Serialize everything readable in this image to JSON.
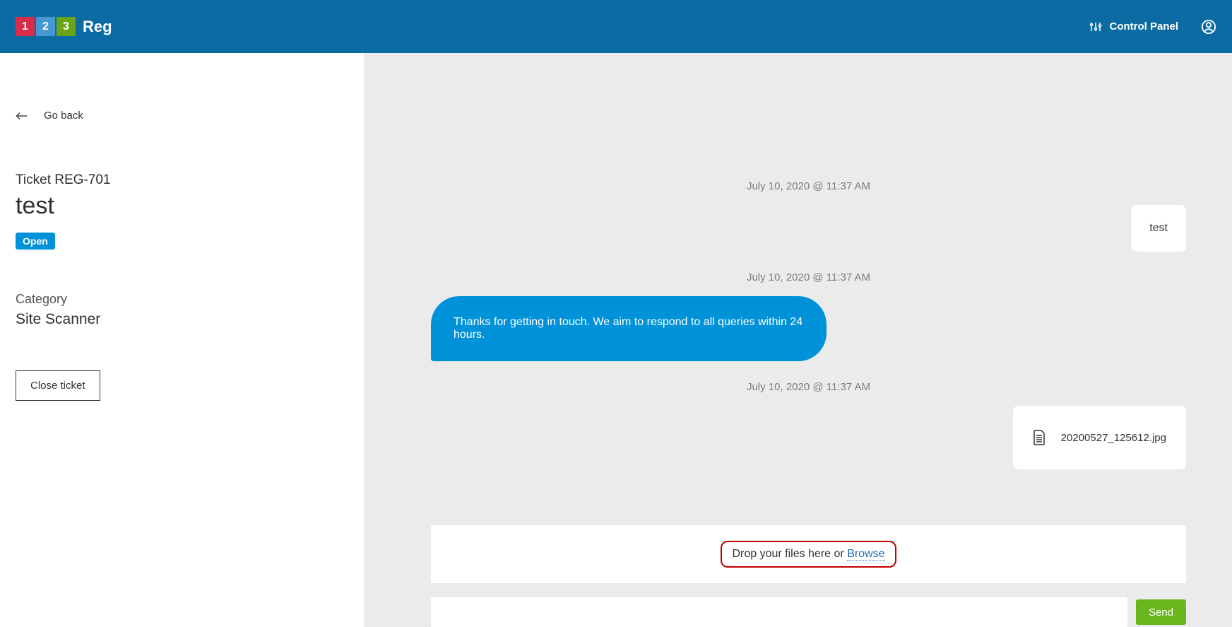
{
  "header": {
    "logo_1": "1",
    "logo_2": "2",
    "logo_3": "3",
    "logo_text": "Reg",
    "control_panel": "Control Panel"
  },
  "sidebar": {
    "go_back": "Go back",
    "ticket_label": "Ticket REG-701",
    "ticket_title": "test",
    "status": "Open",
    "category_label": "Category",
    "category_value": "Site Scanner",
    "close_ticket": "Close ticket"
  },
  "conversation": {
    "timestamp1": "July 10, 2020 @ 11:37 AM",
    "msg1": "test",
    "timestamp2": "July 10, 2020 @ 11:37 AM",
    "msg2": "Thanks for getting in touch. We aim to respond to all queries within 24 hours.",
    "timestamp3": "July 10, 2020 @ 11:37 AM",
    "attachment_name": "20200527_125612.jpg"
  },
  "dropzone": {
    "text": "Drop your files here or ",
    "browse": "Browse"
  },
  "compose": {
    "send": "Send",
    "placeholder": ""
  }
}
